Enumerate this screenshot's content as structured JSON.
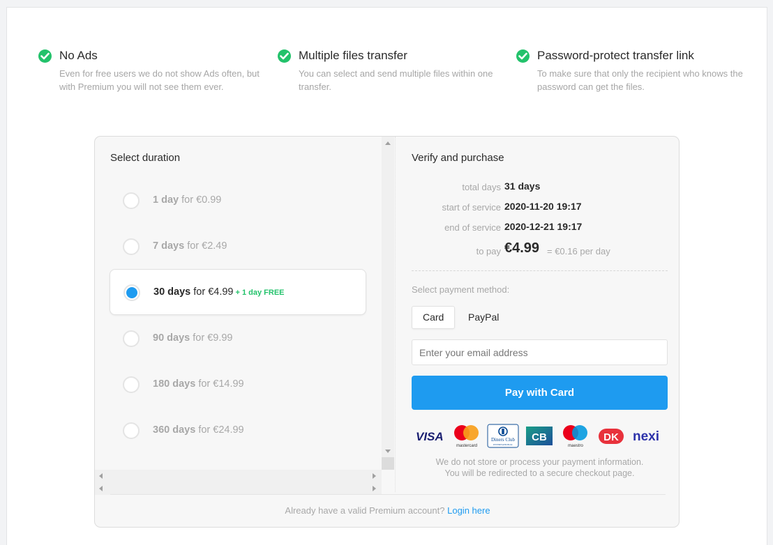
{
  "features": [
    {
      "title": "No Ads",
      "desc": "Even for free users we do not show Ads often, but with Premium you will not see them ever.",
      "icon": "check-circle-icon"
    },
    {
      "title": "Multiple files transfer",
      "desc": "You can select and send multiple files within one transfer.",
      "icon": "check-circle-icon"
    },
    {
      "title": "Password-protect transfer link",
      "desc": "To make sure that only the recipient who knows the password can get the files.",
      "icon": "check-circle-icon"
    }
  ],
  "duration": {
    "heading": "Select duration",
    "selected_index": 2,
    "options": [
      {
        "days": "1 day",
        "price": "for €0.99",
        "bonus": ""
      },
      {
        "days": "7 days",
        "price": "for €2.49",
        "bonus": ""
      },
      {
        "days": "30 days",
        "price": "for €4.99",
        "bonus": "+ 1 day FREE"
      },
      {
        "days": "90 days",
        "price": "for €9.99",
        "bonus": ""
      },
      {
        "days": "180 days",
        "price": "for €14.99",
        "bonus": ""
      },
      {
        "days": "360 days",
        "price": "for €24.99",
        "bonus": ""
      }
    ]
  },
  "purchase": {
    "heading": "Verify and purchase",
    "summary": {
      "total_days_label": "total days",
      "total_days_value": "31 days",
      "start_label": "start of service",
      "start_value": "2020-11-20 19:17",
      "end_label": "end of service",
      "end_value": "2020-12-21 19:17",
      "to_pay_label": "to pay",
      "to_pay_value": "€4.99",
      "per_day": "= €0.16 per day"
    },
    "payment_method_label": "Select payment method:",
    "methods": [
      "Card",
      "PayPal"
    ],
    "active_method": "Card",
    "email_placeholder": "Enter your email address",
    "email_value": "",
    "pay_button": "Pay with Card",
    "logos": [
      "VISA",
      "mastercard",
      "Diners Club International",
      "CB",
      "maestro",
      "Dankort",
      "nexi"
    ],
    "notice_line1": "We do not store or process your payment information.",
    "notice_line2": "You will be redirected to a secure checkout page."
  },
  "footer": {
    "text": "Already have a valid Premium account?",
    "link": "Login here"
  },
  "colors": {
    "accent": "#1e9bf0",
    "success": "#23c26b"
  }
}
